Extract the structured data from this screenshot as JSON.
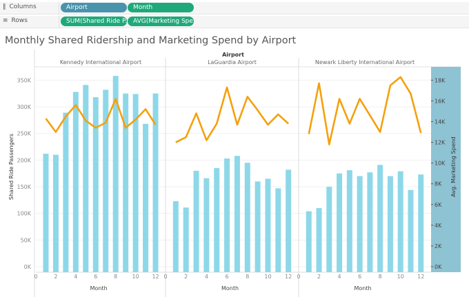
{
  "shelves": {
    "columns": {
      "label": "Columns",
      "icon": "columns-icon",
      "pills": [
        {
          "text": "Airport",
          "color": "#4a93ad"
        },
        {
          "text": "Month",
          "color": "#1fa97a"
        }
      ]
    },
    "rows": {
      "label": "Rows",
      "icon": "rows-icon",
      "pills": [
        {
          "text": "SUM(Shared Ride P..",
          "color": "#1fa97a"
        },
        {
          "text": "AVG(Marketing Spe..",
          "color": "#1fa97a"
        }
      ]
    }
  },
  "chart_data": {
    "type": "bar+line",
    "title": "Monthly Shared Ridership and Marketing Spend by Airport",
    "column_header": "Airport",
    "xlabel": "Month",
    "ylabel": "Shared Ride Passengers",
    "y2label": "Avg. Marketing Spend",
    "xlim": [
      0,
      13
    ],
    "ylim": [
      0,
      375000
    ],
    "y2lim": [
      0,
      19286
    ],
    "xticks": [
      0,
      2,
      4,
      6,
      8,
      10,
      12
    ],
    "yticks": [
      "0K",
      "50K",
      "100K",
      "150K",
      "200K",
      "250K",
      "300K",
      "350K"
    ],
    "y2ticks": [
      "0K",
      "2K",
      "4K",
      "6K",
      "8K",
      "10K",
      "12K",
      "14K",
      "16K",
      "18K"
    ],
    "grid": true,
    "bar_color": "#8dd8e8",
    "line_color": "#f5a00c",
    "axis2_bg": "#8ec3d4",
    "months": [
      1,
      2,
      3,
      4,
      5,
      6,
      7,
      8,
      9,
      10,
      11,
      12
    ],
    "panes": [
      {
        "name": "Kennedy International Airport",
        "passengers": [
          212000,
          210000,
          289000,
          328000,
          341000,
          318000,
          332000,
          358000,
          325000,
          324000,
          268000,
          325000
        ],
        "marketing": [
          14300,
          13000,
          14500,
          15600,
          14100,
          13400,
          13900,
          16200,
          13400,
          14200,
          15200,
          13700
        ]
      },
      {
        "name": "LaGuardia Airport",
        "passengers": [
          123000,
          111000,
          180000,
          166000,
          185000,
          203000,
          208000,
          195000,
          160000,
          165000,
          147000,
          182000
        ],
        "marketing": [
          12000,
          12500,
          14800,
          12200,
          13800,
          17300,
          13700,
          16400,
          15100,
          13700,
          14700,
          13800
        ]
      },
      {
        "name": "Newark Liberty International Airport",
        "passengers": [
          104000,
          110000,
          150000,
          175000,
          181000,
          170000,
          177000,
          191000,
          170000,
          179000,
          144000,
          173000
        ],
        "marketing": [
          12800,
          17700,
          11800,
          16200,
          13800,
          16200,
          14600,
          13000,
          17500,
          18300,
          16700,
          12900
        ]
      }
    ]
  }
}
